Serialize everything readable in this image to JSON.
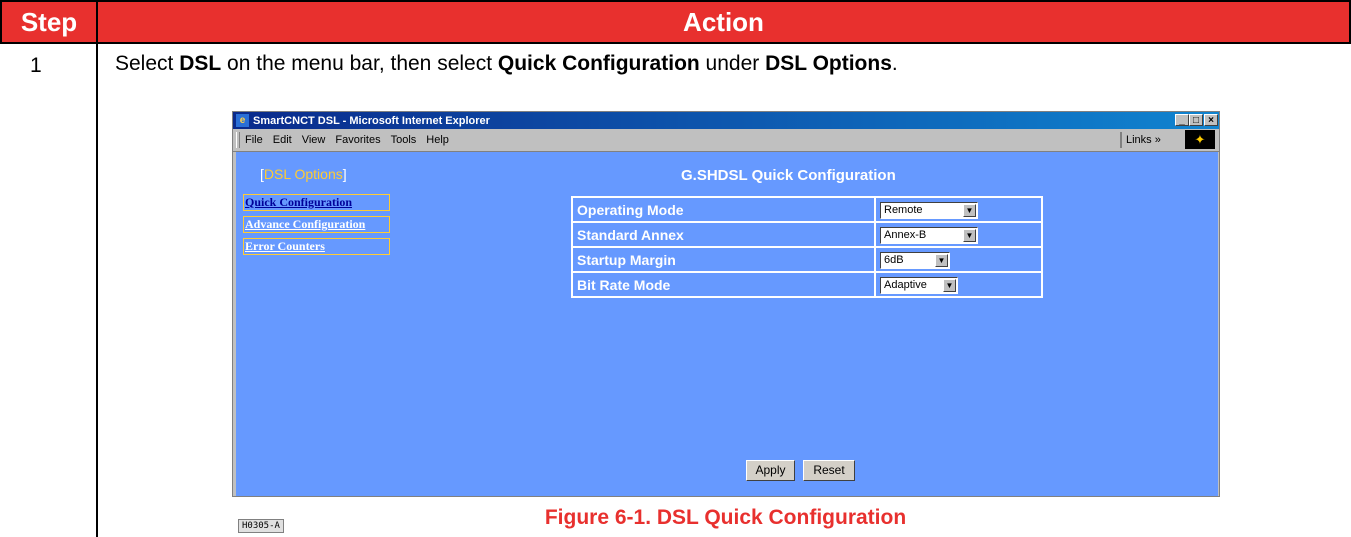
{
  "table": {
    "header_step": "Step",
    "header_action": "Action",
    "step_number": "1",
    "instruction": {
      "t1": "Select ",
      "b1": "DSL",
      "t2": " on the menu bar, then select ",
      "b2": "Quick Configuration",
      "t3": " under ",
      "b3": "DSL Options",
      "t4": "."
    },
    "caption": "Figure 6-1. DSL Quick Configuration"
  },
  "browser": {
    "title": "SmartCNCT DSL - Microsoft Internet Explorer",
    "menu": [
      "File",
      "Edit",
      "View",
      "Favorites",
      "Tools",
      "Help"
    ],
    "links_label": "Links »",
    "window_buttons": [
      "_",
      "□",
      "×"
    ]
  },
  "page": {
    "sidebar_heading_open": "[",
    "sidebar_heading": "DSL Options",
    "sidebar_heading_close": "]",
    "title": "G.SHDSL Quick Configuration",
    "nav": [
      "Quick Configuration",
      "Advance Configuration",
      "Error Counters"
    ],
    "rows": [
      {
        "label": "Operating Mode",
        "value": "Remote"
      },
      {
        "label": "Standard Annex",
        "value": "Annex-B"
      },
      {
        "label": "Startup Margin",
        "value": "6dB"
      },
      {
        "label": "Bit Rate Mode",
        "value": "Adaptive"
      }
    ],
    "apply_label": "Apply",
    "reset_label": "Reset",
    "figure_id": "H0305-A"
  },
  "colors": {
    "header_red": "#e8302e",
    "page_blue": "#6699ff",
    "nav_gold": "#ffcc33"
  }
}
